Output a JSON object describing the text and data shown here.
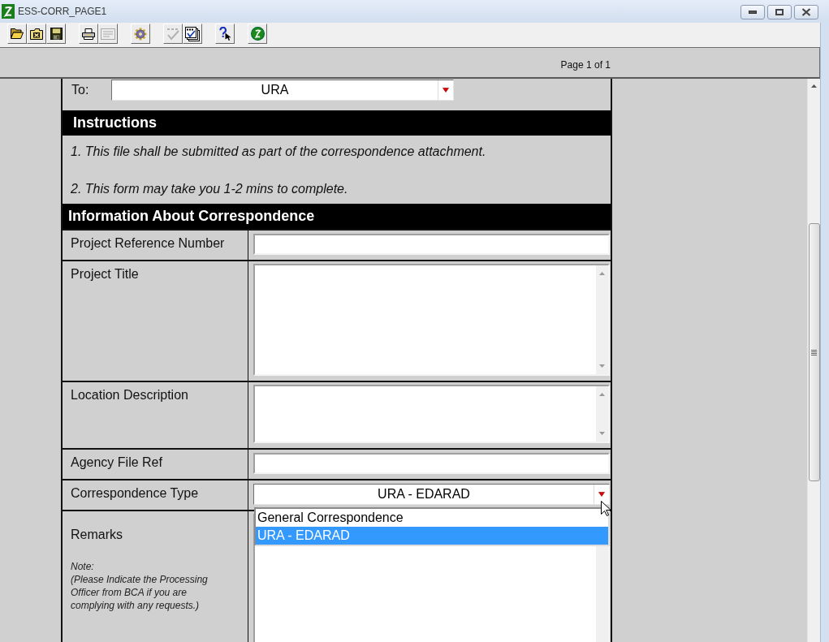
{
  "window": {
    "title": "ESS-CORR_PAGE1"
  },
  "toolbar": [
    {
      "buttons": [
        {
          "disabled": false
        },
        {
          "disabled": false
        },
        {
          "disabled": false
        }
      ]
    },
    {
      "buttons": [
        {
          "disabled": false
        },
        {
          "disabled": true
        }
      ]
    },
    {
      "buttons": [
        {
          "disabled": false
        }
      ]
    },
    {
      "buttons": [
        {
          "disabled": true
        },
        {
          "disabled": false
        }
      ]
    },
    {
      "buttons": [
        {
          "disabled": false
        }
      ]
    },
    {
      "buttons": [
        {
          "disabled": false
        }
      ]
    }
  ],
  "page_bar": {
    "page_label": "Page 1 of 1"
  },
  "form": {
    "to": {
      "label": "To:",
      "value": "URA"
    },
    "instructions": {
      "heading": "Instructions",
      "lines": [
        "1. This file shall be submitted as part of the correspondence attachment.",
        "2. This form may take you 1-2 mins to complete."
      ]
    },
    "correspondence": {
      "heading": "Information About Correspondence",
      "rows": [
        {
          "label": "Project Reference Number",
          "kind": "text"
        },
        {
          "label": "Project Title",
          "kind": "textarea"
        },
        {
          "label": "Location Description",
          "kind": "textarea"
        },
        {
          "label": "Agency File Ref",
          "kind": "text"
        },
        {
          "label": "Correspondence Type",
          "kind": "select",
          "value": "URA - EDARAD",
          "expanded": true,
          "options": [
            {
              "label": "General Correspondence",
              "selected": false
            },
            {
              "label": "URA - EDARAD",
              "selected": true
            }
          ]
        },
        {
          "label": "Remarks",
          "kind": "textarea",
          "note": "Note:\n(Please Indicate the Processing Officer from BCA if you are complying with any requests.)"
        }
      ]
    }
  }
}
